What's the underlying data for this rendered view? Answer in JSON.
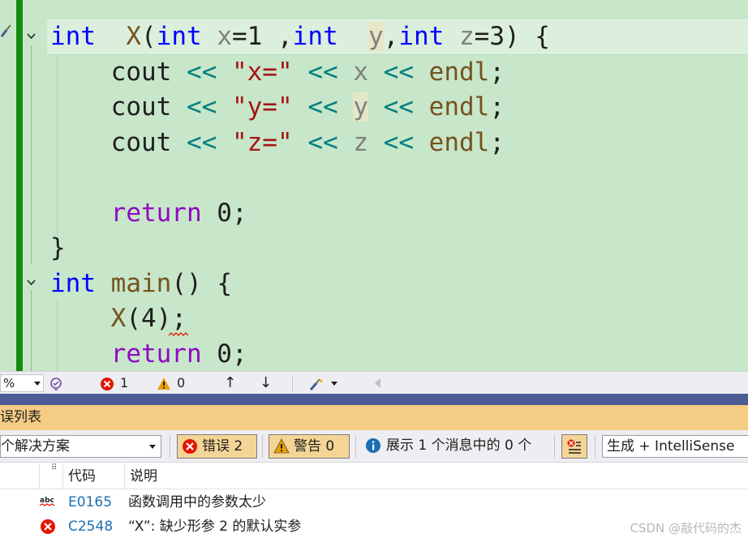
{
  "editor": {
    "lines": [
      [
        [
          "kw",
          "int"
        ],
        [
          "",
          "  "
        ],
        [
          "fn",
          "X"
        ],
        [
          "",
          "("
        ],
        [
          "kw",
          "int"
        ],
        [
          "",
          ""
        ],
        [
          "pm",
          " x"
        ],
        [
          "",
          "=1 ,"
        ],
        [
          "kw",
          "int"
        ],
        [
          "",
          "  "
        ],
        [
          "pmhl",
          "y"
        ],
        [
          "",
          ","
        ],
        [
          "kw",
          "int"
        ],
        [
          "",
          ""
        ],
        [
          "pm",
          " z"
        ],
        [
          "",
          "=3) {"
        ]
      ],
      [
        [
          "",
          "    cout "
        ],
        [
          "op",
          "<<"
        ],
        [
          "",
          " "
        ],
        [
          "st",
          "\"x=\""
        ],
        [
          "",
          " "
        ],
        [
          "op",
          "<<"
        ],
        [
          "",
          " "
        ],
        [
          "pm",
          "x"
        ],
        [
          "",
          " "
        ],
        [
          "op",
          "<<"
        ],
        [
          "",
          " "
        ],
        [
          "fn",
          "endl"
        ],
        [
          "",
          ";"
        ]
      ],
      [
        [
          "",
          "    cout "
        ],
        [
          "op",
          "<<"
        ],
        [
          "",
          " "
        ],
        [
          "st",
          "\"y=\""
        ],
        [
          "",
          " "
        ],
        [
          "op",
          "<<"
        ],
        [
          "",
          " "
        ],
        [
          "pmhl",
          "y"
        ],
        [
          "",
          " "
        ],
        [
          "op",
          "<<"
        ],
        [
          "",
          " "
        ],
        [
          "fn",
          "endl"
        ],
        [
          "",
          ";"
        ]
      ],
      [
        [
          "",
          "    cout "
        ],
        [
          "op",
          "<<"
        ],
        [
          "",
          " "
        ],
        [
          "st",
          "\"z=\""
        ],
        [
          "",
          " "
        ],
        [
          "op",
          "<<"
        ],
        [
          "",
          " "
        ],
        [
          "pm",
          "z"
        ],
        [
          "",
          " "
        ],
        [
          "op",
          "<<"
        ],
        [
          "",
          " "
        ],
        [
          "fn",
          "endl"
        ],
        [
          "",
          ";"
        ]
      ],
      [],
      [
        [
          "",
          "    "
        ],
        [
          "ctl",
          "return"
        ],
        [
          "",
          " 0;"
        ]
      ],
      [
        [
          "",
          "}"
        ]
      ],
      [
        [
          "kw",
          "int"
        ],
        [
          "",
          " "
        ],
        [
          "fn",
          "main"
        ],
        [
          "",
          "() {"
        ]
      ],
      [
        [
          "",
          "    "
        ],
        [
          "fn",
          "X"
        ],
        [
          "",
          "(4);"
        ]
      ],
      [
        [
          "",
          "    "
        ],
        [
          "ctl",
          "return"
        ],
        [
          "",
          " 0;"
        ]
      ]
    ]
  },
  "status": {
    "zoom": "%",
    "errors": "1",
    "warnings": "0",
    "up_arrow": "↑",
    "down_arrow": "↓"
  },
  "panel": {
    "title": "误列表",
    "scope": "个解决方案",
    "errors_label": "错误 2",
    "warnings_label": "警告 0",
    "messages_label": "展示 1 个消息中的 0 个",
    "build_filter": "生成 + IntelliSense",
    "columns": [
      "代码",
      "说明"
    ]
  },
  "rows": [
    {
      "icon": "spell-check-icon",
      "code": "E0165",
      "desc": "函数调用中的参数太少"
    },
    {
      "icon": "error-icon",
      "code": "C2548",
      "desc": "“X”: 缺少形参 2 的默认实参"
    }
  ],
  "watermark": "CSDN @敲代码的杰",
  "colors": {
    "editor_bg": "#c8e6c9",
    "change_bar": "#138b13",
    "panel_title_bg": "#f5cc84",
    "splitter": "#4d5c94",
    "keyword": "#0000ff",
    "function": "#74531f",
    "string": "#a31515",
    "control": "#8f08c4",
    "operator": "#008080",
    "parameter": "#808080",
    "error_red": "#e51400"
  }
}
